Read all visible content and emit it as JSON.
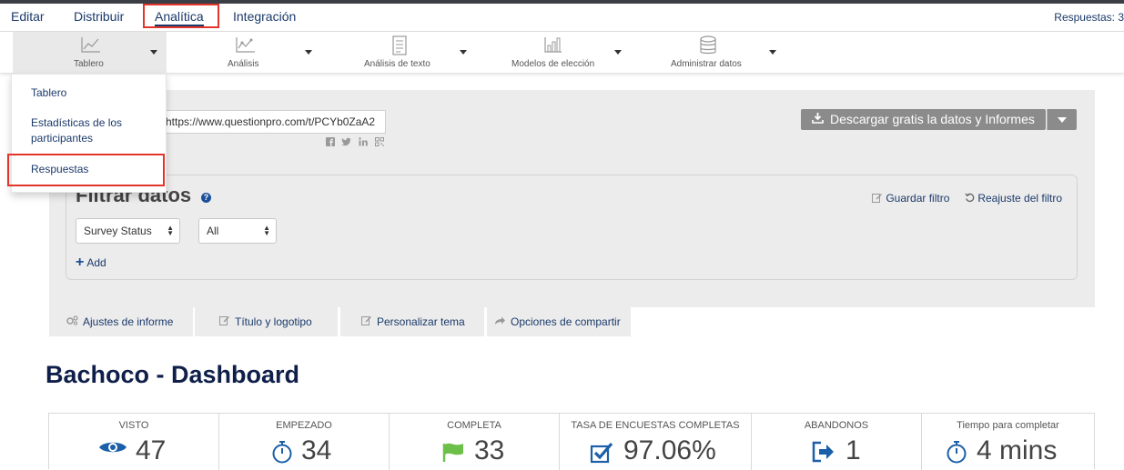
{
  "nav": {
    "tabs": [
      {
        "label": "Editar"
      },
      {
        "label": "Distribuir"
      },
      {
        "label": "Analítica"
      },
      {
        "label": "Integración"
      }
    ],
    "responses_count": "Respuestas: 3"
  },
  "subnav": {
    "items": [
      {
        "label": "Tablero",
        "icon": "line-chart-icon"
      },
      {
        "label": "Análisis",
        "icon": "analysis-chart-icon"
      },
      {
        "label": "Análisis de texto",
        "icon": "text-document-icon"
      },
      {
        "label": "Modelos de elección",
        "icon": "bar-chart-icon"
      },
      {
        "label": "Administrar datos",
        "icon": "database-icon"
      }
    ]
  },
  "dropdown": {
    "items": [
      {
        "label": "Tablero"
      },
      {
        "label": "Estadísticas de los participantes"
      },
      {
        "label": "Respuestas"
      }
    ]
  },
  "share": {
    "url": "https://www.questionpro.com/t/PCYb0ZaA2",
    "social_icons": [
      "facebook-icon",
      "twitter-icon",
      "linkedin-icon",
      "qr-code-icon"
    ]
  },
  "download": {
    "label": "Descargar gratis la datos y Informes"
  },
  "filter": {
    "title": "Filtrar datos",
    "save_label": "Guardar filtro",
    "reset_label": "Reajuste del filtro",
    "field_select": "Survey Status",
    "value_select": "All",
    "add_label": "Add"
  },
  "report_tabs": [
    {
      "label": "Ajustes de informe",
      "icon": "gears-icon"
    },
    {
      "label": "Título y logotipo",
      "icon": "pencil-icon"
    },
    {
      "label": "Personalizar tema",
      "icon": "pencil-icon"
    },
    {
      "label": "Opciones de compartir",
      "icon": "share-arrow-icon"
    }
  ],
  "dashboard": {
    "title": "Bachoco - Dashboard",
    "stats": [
      {
        "label": "VISTO",
        "value": "47",
        "icon": "eye-icon",
        "color": "#1b5fa8"
      },
      {
        "label": "EMPEZADO",
        "value": "34",
        "icon": "stopwatch-icon",
        "color": "#1b5fa8"
      },
      {
        "label": "COMPLETA",
        "value": "33",
        "icon": "flag-icon",
        "color": "#6cc04a"
      },
      {
        "label": "TASA DE ENCUESTAS COMPLETAS",
        "value": "97.06%",
        "icon": "checkbox-icon",
        "color": "#1b5fa8"
      },
      {
        "label": "ABANDONOS",
        "value": "1",
        "icon": "exit-icon",
        "color": "#1b5fa8"
      },
      {
        "label": "Tiempo para completar",
        "value": "4 mins",
        "icon": "stopwatch-icon",
        "color": "#1b5fa8"
      }
    ]
  },
  "colors": {
    "highlight": "#e2342a",
    "nav_text": "#1b3a6b",
    "panel_bg": "#ececec",
    "button_gray": "#8b8b8b"
  }
}
